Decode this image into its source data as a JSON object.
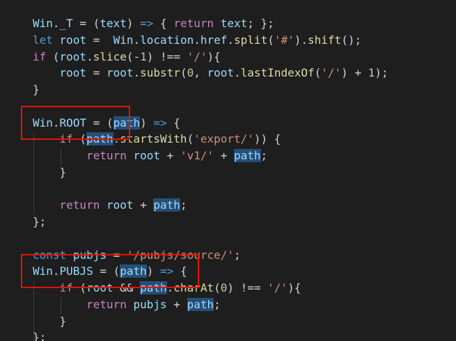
{
  "colors": {
    "background": "#1e1e1e",
    "default": "#d4d4d4",
    "identifier": "#9cdcfe",
    "keyword": "#569cd6",
    "control": "#c586c0",
    "function": "#dcdcaa",
    "string": "#ce9178",
    "number": "#b5cea8",
    "highlight_box": "#e51400",
    "word_highlight": "#264f78"
  },
  "code_lines": [
    [
      [
        "Win",
        "identifier"
      ],
      [
        ".",
        "default"
      ],
      [
        "_T",
        "identifier"
      ],
      [
        " = (",
        "default"
      ],
      [
        "text",
        "identifier"
      ],
      [
        ") ",
        "default"
      ],
      [
        "=>",
        "keyword"
      ],
      [
        " { ",
        "default"
      ],
      [
        "return",
        "control"
      ],
      [
        " ",
        "default"
      ],
      [
        "text",
        "identifier"
      ],
      [
        "; };",
        "default"
      ]
    ],
    [
      [
        "let",
        "keyword"
      ],
      [
        " ",
        "default"
      ],
      [
        "root",
        "identifier"
      ],
      [
        " =  ",
        "default"
      ],
      [
        "Win",
        "identifier"
      ],
      [
        ".",
        "default"
      ],
      [
        "location",
        "identifier"
      ],
      [
        ".",
        "default"
      ],
      [
        "href",
        "identifier"
      ],
      [
        ".",
        "default"
      ],
      [
        "split",
        "function"
      ],
      [
        "(",
        "default"
      ],
      [
        "'#'",
        "string"
      ],
      [
        ").",
        "default"
      ],
      [
        "shift",
        "function"
      ],
      [
        "();",
        "default"
      ]
    ],
    [
      [
        "if",
        "control"
      ],
      [
        " (",
        "default"
      ],
      [
        "root",
        "identifier"
      ],
      [
        ".",
        "default"
      ],
      [
        "slice",
        "function"
      ],
      [
        "(-",
        "default"
      ],
      [
        "1",
        "number"
      ],
      [
        ") !== ",
        "default"
      ],
      [
        "'/'",
        "string"
      ],
      [
        "){",
        "default"
      ]
    ],
    [
      [
        "    ",
        "default"
      ],
      [
        "root",
        "identifier"
      ],
      [
        " = ",
        "default"
      ],
      [
        "root",
        "identifier"
      ],
      [
        ".",
        "default"
      ],
      [
        "substr",
        "function"
      ],
      [
        "(",
        "default"
      ],
      [
        "0",
        "number"
      ],
      [
        ", ",
        "default"
      ],
      [
        "root",
        "identifier"
      ],
      [
        ".",
        "default"
      ],
      [
        "lastIndexOf",
        "function"
      ],
      [
        "(",
        "default"
      ],
      [
        "'/'",
        "string"
      ],
      [
        ") + ",
        "default"
      ],
      [
        "1",
        "number"
      ],
      [
        ");",
        "default"
      ]
    ],
    [
      [
        "}",
        "default"
      ]
    ],
    [],
    [
      [
        "Win",
        "identifier"
      ],
      [
        ".",
        "default"
      ],
      [
        "ROOT",
        "identifier"
      ],
      [
        " = (",
        "default"
      ],
      [
        "path",
        "identifier",
        "hl"
      ],
      [
        ") ",
        "default"
      ],
      [
        "=>",
        "keyword"
      ],
      [
        " {",
        "default"
      ]
    ],
    [
      [
        "    ",
        "default"
      ],
      [
        "if",
        "control"
      ],
      [
        " (",
        "default"
      ],
      [
        "path",
        "identifier",
        "hl"
      ],
      [
        ".",
        "default"
      ],
      [
        "startsWith",
        "function"
      ],
      [
        "(",
        "default"
      ],
      [
        "'export/'",
        "string"
      ],
      [
        ")) {",
        "default"
      ]
    ],
    [
      [
        "        ",
        "default"
      ],
      [
        "return",
        "control"
      ],
      [
        " ",
        "default"
      ],
      [
        "root",
        "identifier"
      ],
      [
        " + ",
        "default"
      ],
      [
        "'v1/'",
        "string"
      ],
      [
        " + ",
        "default"
      ],
      [
        "path",
        "identifier",
        "hl"
      ],
      [
        ";",
        "default"
      ]
    ],
    [
      [
        "    ",
        "default"
      ],
      [
        "}",
        "default"
      ]
    ],
    [],
    [
      [
        "    ",
        "default"
      ],
      [
        "return",
        "control"
      ],
      [
        " ",
        "default"
      ],
      [
        "root",
        "identifier"
      ],
      [
        " + ",
        "default"
      ],
      [
        "path",
        "identifier",
        "hl"
      ],
      [
        ";",
        "default"
      ]
    ],
    [
      [
        "};",
        "default"
      ]
    ],
    [],
    [
      [
        "const",
        "keyword"
      ],
      [
        " ",
        "default"
      ],
      [
        "pubjs",
        "identifier"
      ],
      [
        " = ",
        "default"
      ],
      [
        "'/pubjs/source/'",
        "string"
      ],
      [
        ";",
        "default"
      ]
    ],
    [
      [
        "Win",
        "identifier"
      ],
      [
        ".",
        "default"
      ],
      [
        "PUBJS",
        "identifier"
      ],
      [
        " = (",
        "default"
      ],
      [
        "path",
        "identifier",
        "hl"
      ],
      [
        ") ",
        "default"
      ],
      [
        "=>",
        "keyword"
      ],
      [
        " {",
        "default"
      ]
    ],
    [
      [
        "    ",
        "default"
      ],
      [
        "if",
        "control"
      ],
      [
        " (",
        "default"
      ],
      [
        "root",
        "identifier"
      ],
      [
        " && ",
        "default"
      ],
      [
        "path",
        "identifier",
        "hl"
      ],
      [
        ".",
        "default"
      ],
      [
        "charAt",
        "function"
      ],
      [
        "(",
        "default"
      ],
      [
        "0",
        "number"
      ],
      [
        ") !== ",
        "default"
      ],
      [
        "'/'",
        "string"
      ],
      [
        "){",
        "default"
      ]
    ],
    [
      [
        "        ",
        "default"
      ],
      [
        "return",
        "control"
      ],
      [
        " ",
        "default"
      ],
      [
        "pubjs",
        "identifier"
      ],
      [
        " + ",
        "default"
      ],
      [
        "path",
        "identifier",
        "hl"
      ],
      [
        ";",
        "default"
      ]
    ],
    [
      [
        "    ",
        "default"
      ],
      [
        "}",
        "default"
      ]
    ],
    [
      [
        "};",
        "default"
      ]
    ]
  ]
}
